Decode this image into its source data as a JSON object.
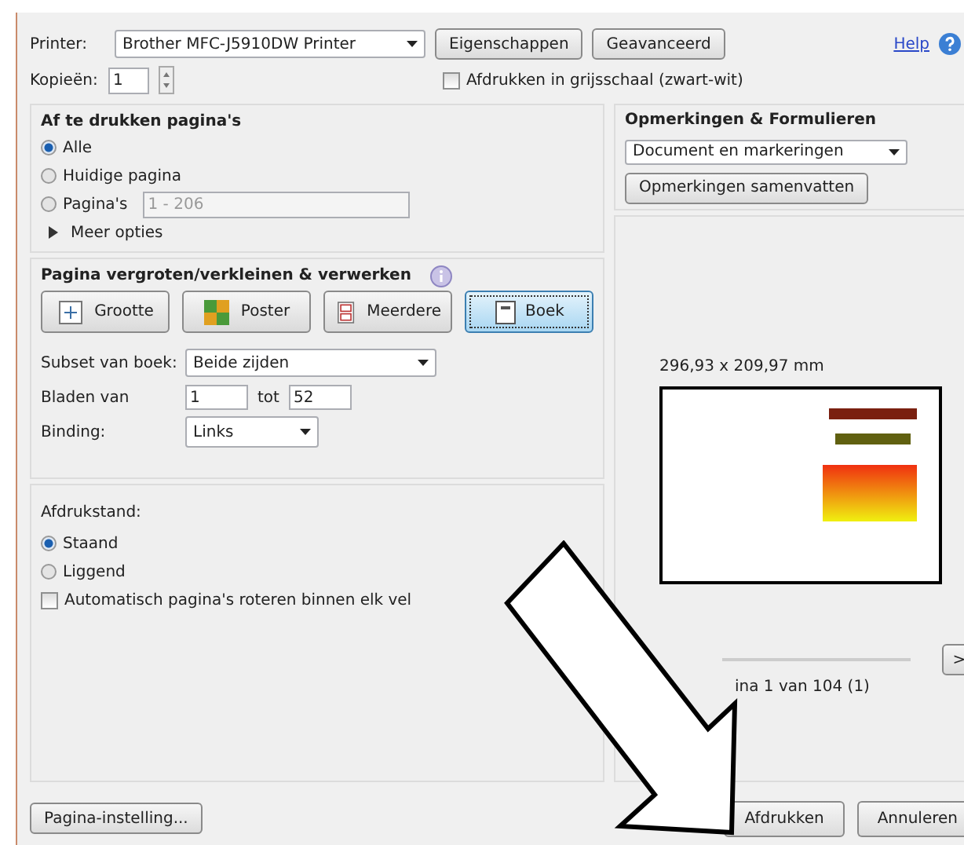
{
  "printer": {
    "label": "Printer:",
    "value": "Brother MFC-J5910DW Printer"
  },
  "top_buttons": [
    "Eigenschappen",
    "Geavanceerd"
  ],
  "help": "Help",
  "copies": {
    "label": "Kopieën:",
    "value": "1"
  },
  "grayscale": {
    "label": "Afdrukken in grijsschaal (zwart-wit)",
    "checked": false
  },
  "pages": {
    "title": "Af te drukken pagina's",
    "options": [
      {
        "kind": "plain",
        "label": "Alle",
        "selected": true
      },
      {
        "kind": "plain",
        "label": "Huidige pagina",
        "selected": false
      },
      {
        "kind": "range",
        "label": "Pagina's",
        "selected": false,
        "value": "1 - 206",
        "disabled": true
      }
    ],
    "more": "Meer opties"
  },
  "sizing": {
    "title": "Pagina vergroten/verkleinen & verwerken",
    "modes": [
      {
        "kind": "size",
        "label": "Grootte",
        "selected": false
      },
      {
        "kind": "poster",
        "label": "Poster",
        "selected": false
      },
      {
        "kind": "multiple",
        "label": "Meerdere",
        "selected": false
      },
      {
        "kind": "book",
        "label": "Boek",
        "selected": true
      }
    ]
  },
  "book": {
    "subset": {
      "label": "Subset van boek:",
      "value": "Beide zijden"
    },
    "sheets": {
      "label": "Bladen van",
      "from": "1",
      "to_label": "tot",
      "to": "52"
    },
    "binding": {
      "label": "Binding:",
      "value": "Links"
    }
  },
  "orientation": {
    "title": "Afdrukstand:",
    "options": [
      {
        "label": "Staand",
        "selected": true
      },
      {
        "label": "Liggend",
        "selected": false
      }
    ],
    "auto_rotate": {
      "label": "Automatisch pagina's roteren binnen elk vel",
      "checked": false
    }
  },
  "comments": {
    "title": "Opmerkingen & Formulieren",
    "value": "Document en markeringen",
    "button": "Opmerkingen samenvatten"
  },
  "preview": {
    "size": "296,93 x 209,97 mm",
    "next": ">",
    "page_info": "ina 1 van 104 (1)"
  },
  "footer": {
    "setup": "Pagina-instelling...",
    "print": "Afdrukken",
    "cancel": "Annuleren"
  }
}
